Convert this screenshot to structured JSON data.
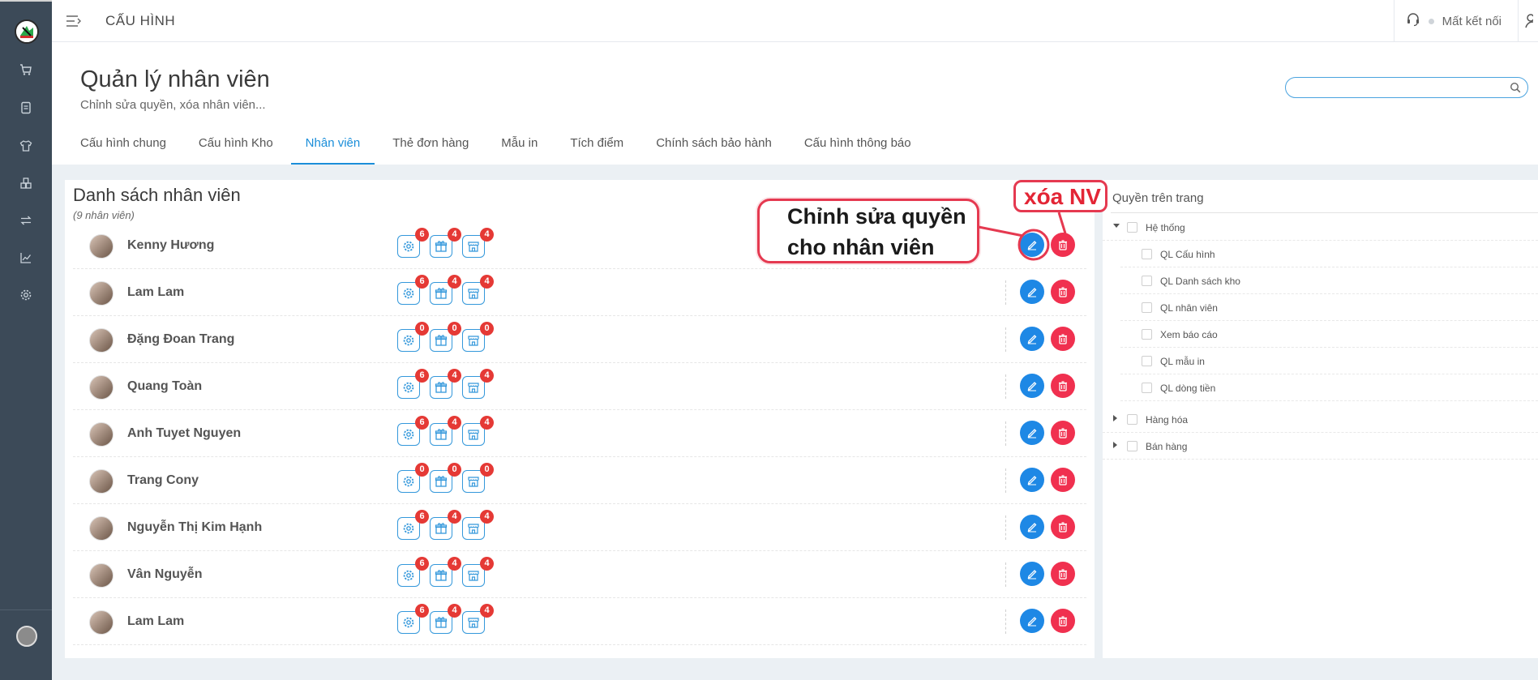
{
  "header": {
    "section_title": "CẤU HÌNH",
    "connection_status": "Mất kết nối"
  },
  "page": {
    "title": "Quản lý nhân viên",
    "subtitle": "Chỉnh sửa quyền, xóa nhân viên...",
    "search": {
      "placeholder": "",
      "value": ""
    }
  },
  "tabs": [
    {
      "label": "Cấu hình chung",
      "active": false
    },
    {
      "label": "Cấu hình Kho",
      "active": false
    },
    {
      "label": "Nhân viên",
      "active": true
    },
    {
      "label": "Thẻ đơn hàng",
      "active": false
    },
    {
      "label": "Mẫu in",
      "active": false
    },
    {
      "label": "Tích điểm",
      "active": false
    },
    {
      "label": "Chính sách bảo hành",
      "active": false
    },
    {
      "label": "Cấu hình thông báo",
      "active": false
    }
  ],
  "employees": {
    "title": "Danh sách nhân viên",
    "count_label": "(9 nhân viên)",
    "rows": [
      {
        "name": "Kenny Hương",
        "badges": [
          "6",
          "4",
          "4"
        ]
      },
      {
        "name": "Lam Lam",
        "badges": [
          "6",
          "4",
          "4"
        ]
      },
      {
        "name": "Đặng Đoan Trang",
        "badges": [
          "0",
          "0",
          "0"
        ]
      },
      {
        "name": "Quang Toàn",
        "badges": [
          "6",
          "4",
          "4"
        ]
      },
      {
        "name": "Anh Tuyet Nguyen",
        "badges": [
          "6",
          "4",
          "4"
        ]
      },
      {
        "name": "Trang Cony",
        "badges": [
          "0",
          "0",
          "0"
        ]
      },
      {
        "name": "Nguyễn Thị Kim Hạnh",
        "badges": [
          "6",
          "4",
          "4"
        ]
      },
      {
        "name": "Vân Nguyễn",
        "badges": [
          "6",
          "4",
          "4"
        ]
      },
      {
        "name": "Lam Lam",
        "badges": [
          "6",
          "4",
          "4"
        ]
      }
    ]
  },
  "permissions": {
    "title": "Quyền trên trang",
    "tree": [
      {
        "label": "Hệ thống",
        "expanded": true,
        "children": [
          {
            "label": "QL Cấu hình"
          },
          {
            "label": "QL Danh sách kho"
          },
          {
            "label": "QL nhân viên"
          },
          {
            "label": "Xem báo cáo"
          },
          {
            "label": "QL mẫu in"
          },
          {
            "label": "QL dòng tiền"
          }
        ]
      },
      {
        "label": "Hàng hóa",
        "expanded": false
      },
      {
        "label": "Bán hàng",
        "expanded": false
      }
    ]
  },
  "annotations": {
    "edit_note": "Chỉnh sửa quyền\ncho nhân viên",
    "delete_note": "xóa NV"
  },
  "colors": {
    "rail": "#3c4a58",
    "accent": "#1b8ed9",
    "edit_button": "#1e88e5",
    "delete_button": "#f0304f",
    "badge": "#e53935",
    "annotation": "#e53950"
  },
  "icons": {
    "rail": [
      "cart-icon",
      "document-icon",
      "shirt-icon",
      "boxes-icon",
      "transfer-icon",
      "chart-icon",
      "settings-icon"
    ],
    "permission_groups": [
      "settings-icon",
      "gift-icon",
      "store-icon"
    ]
  }
}
